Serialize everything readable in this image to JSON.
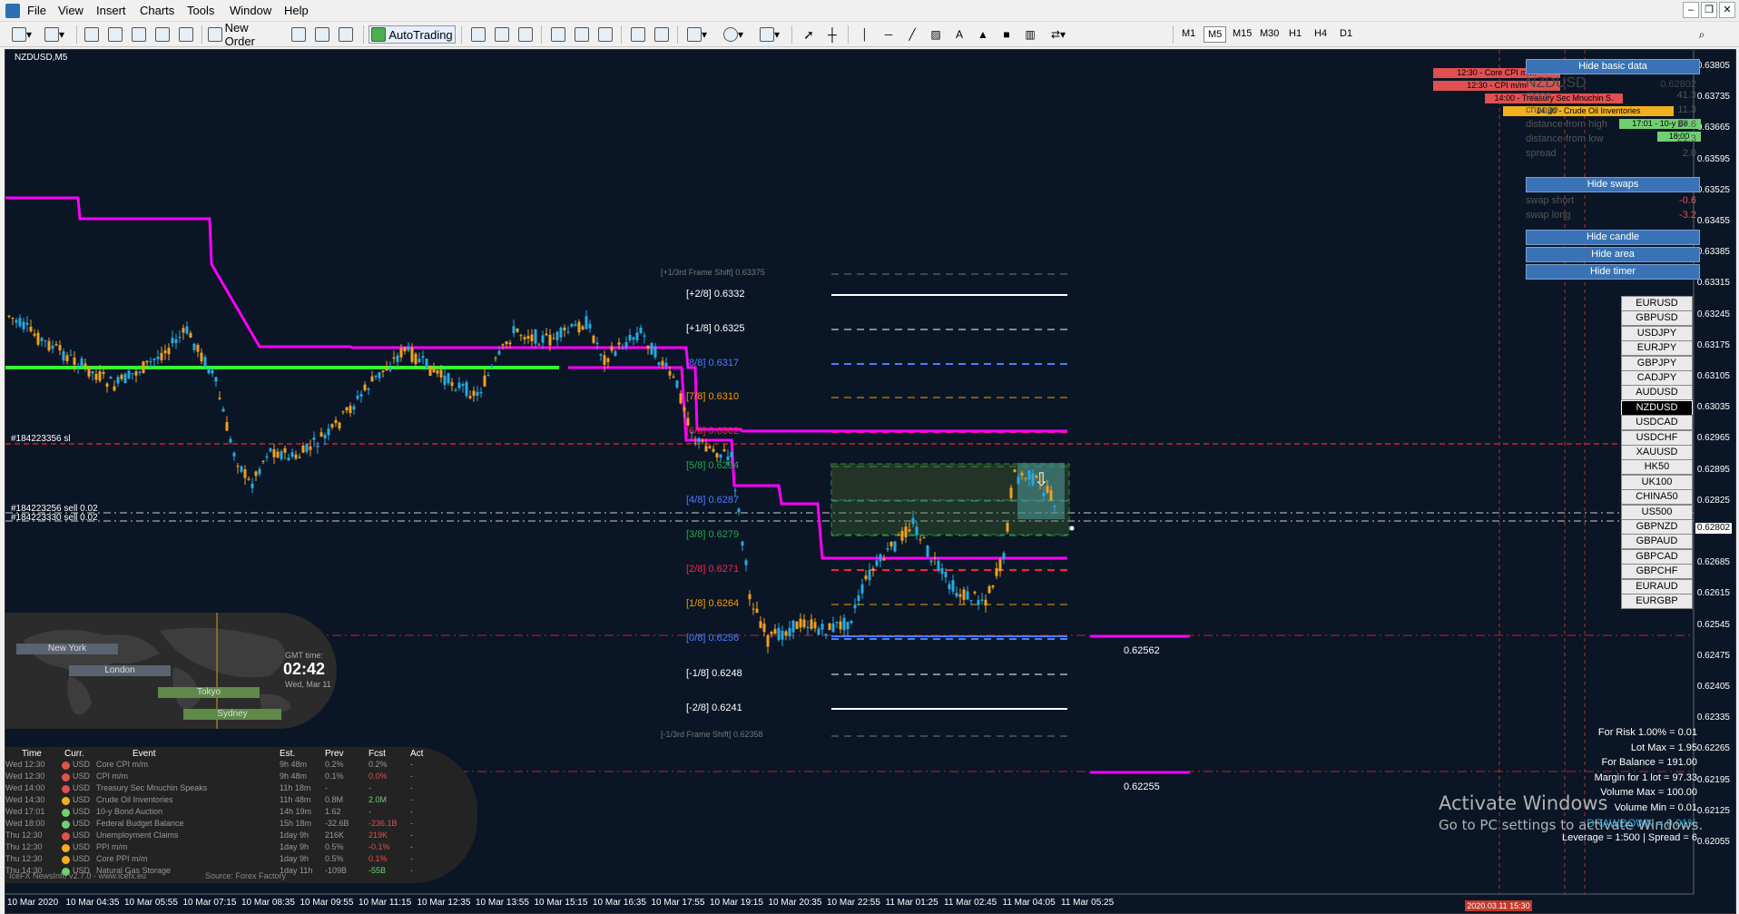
{
  "menu": [
    "File",
    "View",
    "Insert",
    "Charts",
    "Tools",
    "Window",
    "Help"
  ],
  "toolbar": {
    "new_order": "New Order",
    "autotrading": "AutoTrading",
    "timeframes": [
      "M1",
      "M5",
      "M15",
      "M30",
      "H1",
      "H4",
      "D1"
    ],
    "active_tf": "M5"
  },
  "chart": {
    "title": "NZDUSD,M5",
    "current_price": "0.62802",
    "bid_box": "0.62802"
  },
  "price_axis": [
    "0.63805",
    "0.63735",
    "0.63665",
    "0.63595",
    "0.63525",
    "0.63455",
    "0.63385",
    "0.63315",
    "0.63245",
    "0.63175",
    "0.63105",
    "0.63035",
    "0.62965",
    "0.62895",
    "0.62825",
    "0.62755",
    "0.62685",
    "0.62615",
    "0.62545",
    "0.62475",
    "0.62405",
    "0.62335",
    "0.62265",
    "0.62195",
    "0.62125",
    "0.62055"
  ],
  "time_axis": [
    "10 Mar 2020",
    "10 Mar 04:35",
    "10 Mar 05:55",
    "10 Mar 07:15",
    "10 Mar 08:35",
    "10 Mar 09:55",
    "10 Mar 11:15",
    "10 Mar 12:35",
    "10 Mar 13:55",
    "10 Mar 15:15",
    "10 Mar 16:35",
    "10 Mar 17:55",
    "10 Mar 19:15",
    "10 Mar 20:35",
    "10 Mar 22:55",
    "11 Mar 01:25",
    "11 Mar 02:45",
    "11 Mar 04:05",
    "11 Mar 05:25"
  ],
  "murrey": [
    {
      "label": "[+1/3rd Frame Shift]  0.63375",
      "color": "#777"
    },
    {
      "label": "[+2/8]  0.6332",
      "color": "#ffffff"
    },
    {
      "label": "[+1/8]  0.6325",
      "color": "#ffffff"
    },
    {
      "label": "[8/8]  0.6317",
      "color": "#4a7dff"
    },
    {
      "label": "[7/8]  0.6310",
      "color": "#ff9900"
    },
    {
      "label": "[6/8]  0.6302",
      "color": "#ff2040"
    },
    {
      "label": "[5/8]  0.6294",
      "color": "#22aa44"
    },
    {
      "label": "[4/8]  0.6287",
      "color": "#4a7dff"
    },
    {
      "label": "[3/8]  0.6279",
      "color": "#22aa44"
    },
    {
      "label": "[2/8]  0.6271",
      "color": "#ff2040"
    },
    {
      "label": "[1/8]  0.6264",
      "color": "#ff9900"
    },
    {
      "label": "[0/8]  0.6256",
      "color": "#4a7dff"
    },
    {
      "label": "[-1/8]  0.6248",
      "color": "#ffffff"
    },
    {
      "label": "[-2/8]  0.6241",
      "color": "#ffffff"
    },
    {
      "label": "[-1/3rd Frame Shift]  0.62358",
      "color": "#777"
    }
  ],
  "orders": [
    "#184223356 sl",
    "#184223256 sell 0.02",
    "#184223330 sell 0.02"
  ],
  "levels": {
    "level1": "0.62562",
    "level2": "0.62255"
  },
  "panel": {
    "hide_basic": "Hide basic data",
    "rows": [
      {
        "label": "NZDUSD",
        "value": "0.62802"
      },
      {
        "label": "range",
        "value": "41.3"
      },
      {
        "label": "change",
        "value": "11.3"
      },
      {
        "label": "distance from high",
        "value": "17.6"
      },
      {
        "label": "distance from low",
        "value": "21.3"
      },
      {
        "label": "spread",
        "value": "2.0"
      }
    ],
    "hide_swaps": "Hide swaps",
    "swaps": [
      {
        "label": "swap short",
        "value": "-0.6"
      },
      {
        "label": "swap long",
        "value": "-3.2"
      }
    ],
    "hide_candle": "Hide candle",
    "hide_area": "Hide area",
    "hide_timer": "Hide timer"
  },
  "news_bars": [
    {
      "text": "12:30 - Core CPI m/m",
      "color": "#e05050"
    },
    {
      "text": "12:30 - CPI m/m",
      "color": "#e05050"
    },
    {
      "text": "14:00 - Treasury Sec Mnuchin S.",
      "color": "#e05050"
    },
    {
      "text": "14:30 - Crude Oil Inventories",
      "color": "#f0b020"
    },
    {
      "text": "17:01 - 10-y Bo",
      "color": "#6fd070"
    },
    {
      "text": "18:00",
      "color": "#6fd070"
    }
  ],
  "symbols": [
    "EURUSD",
    "GBPUSD",
    "USDJPY",
    "EURJPY",
    "GBPJPY",
    "CADJPY",
    "AUDUSD",
    "NZDUSD",
    "USDCAD",
    "USDCHF",
    "XAUUSD",
    "HK50",
    "UK100",
    "CHINA50",
    "US500",
    "GBPNZD",
    "GBPAUD",
    "GBPCAD",
    "GBPCHF",
    "EURAUD",
    "EURGBP"
  ],
  "active_symbol": "NZDUSD",
  "risk_info": [
    "For Risk 1.00% = 0.01",
    "Lot Max = 1.95",
    "For Balance = 191.00",
    "Margin for 1 lot = 97.33",
    "Volume Max = 100.00",
    "Volume Min = 0.01",
    "DRAWDOWN = 0.01%",
    "Leverage = 1:500 | Spread = 6"
  ],
  "world": {
    "cities": [
      "New York",
      "London",
      "Tokyo",
      "Sydney"
    ],
    "gmt_label": "GMT time:",
    "gmt_time": "02:42",
    "gmt_date": "Wed, Mar 11"
  },
  "news_table": {
    "headers": [
      "Time",
      "Curr.",
      "Event",
      "Est.",
      "Prev",
      "Fcst",
      "Act"
    ],
    "rows": [
      {
        "time": "Wed 12:30",
        "dot": "#e05050",
        "curr": "USD",
        "event": "Core CPI m/m",
        "est": "9h 48m",
        "prev": "0.2%",
        "fcst": "0.2%",
        "fcst_color": "#999",
        "act": "-"
      },
      {
        "time": "Wed 12:30",
        "dot": "#e05050",
        "curr": "USD",
        "event": "CPI m/m",
        "est": "9h 48m",
        "prev": "0.1%",
        "fcst": "0.0%",
        "fcst_color": "#e05050",
        "act": "-"
      },
      {
        "time": "Wed 14:00",
        "dot": "#e05050",
        "curr": "USD",
        "event": "Treasury Sec Mnuchin Speaks",
        "est": "11h 18m",
        "prev": "-",
        "fcst": "-",
        "fcst_color": "#999",
        "act": "-"
      },
      {
        "time": "Wed 14:30",
        "dot": "#f0b020",
        "curr": "USD",
        "event": "Crude Oil Inventories",
        "est": "11h 48m",
        "prev": "0.8M",
        "fcst": "2.0M",
        "fcst_color": "#6fd070",
        "act": "-"
      },
      {
        "time": "Wed 17:01",
        "dot": "#6fd070",
        "curr": "USD",
        "event": "10-y Bond Auction",
        "est": "14h 19m",
        "prev": "1.62",
        "fcst": "-",
        "fcst_color": "#999",
        "act": "-"
      },
      {
        "time": "Wed 18:00",
        "dot": "#6fd070",
        "curr": "USD",
        "event": "Federal Budget Balance",
        "est": "15h 18m",
        "prev": "-32.6B",
        "fcst": "-236.1B",
        "fcst_color": "#e05050",
        "act": "-"
      },
      {
        "time": "Thu 12:30",
        "dot": "#e05050",
        "curr": "USD",
        "event": "Unemployment Claims",
        "est": "1day 9h",
        "prev": "216K",
        "fcst": "219K",
        "fcst_color": "#e05050",
        "act": "-"
      },
      {
        "time": "Thu 12:30",
        "dot": "#f0b020",
        "curr": "USD",
        "event": "PPI m/m",
        "est": "1day 9h",
        "prev": "0.5%",
        "fcst": "-0.1%",
        "fcst_color": "#e05050",
        "act": "-"
      },
      {
        "time": "Thu 12:30",
        "dot": "#f0b020",
        "curr": "USD",
        "event": "Core PPI m/m",
        "est": "1day 9h",
        "prev": "0.5%",
        "fcst": "0.1%",
        "fcst_color": "#e05050",
        "act": "-"
      },
      {
        "time": "Thu 14:30",
        "dot": "#6fd070",
        "curr": "USD",
        "event": "Natural Gas Storage",
        "est": "1day 11h",
        "prev": "-109B",
        "fcst": "-55B",
        "fcst_color": "#6fd070",
        "act": "-"
      }
    ],
    "footer_left": "IceFX NewsInfo v2.7.0  -  www.icefx.eu",
    "footer_right": "Source: Forex Factory"
  },
  "watermark": {
    "line1": "Activate Windows",
    "line2": "Go to PC settings to activate Windows."
  },
  "timestamp_box": "2020.03.11 15:30"
}
